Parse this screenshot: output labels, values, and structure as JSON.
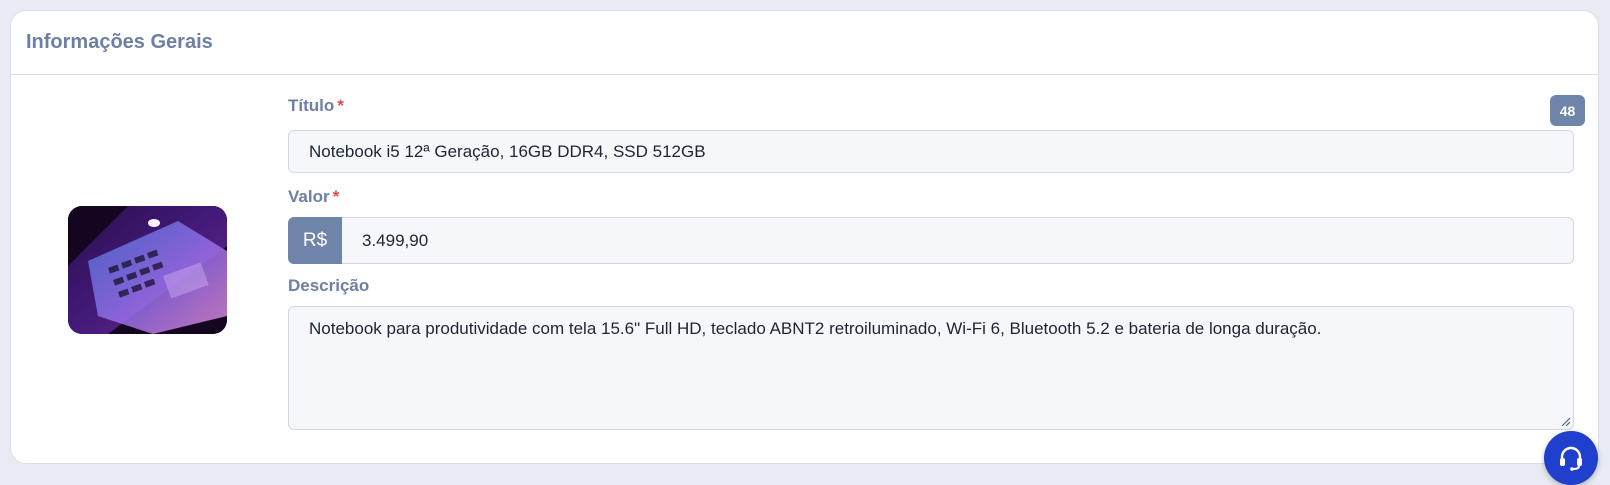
{
  "section": {
    "title": "Informações Gerais"
  },
  "form": {
    "title": {
      "label": "Título",
      "required_mark": "*",
      "value": "Notebook i5 12ª Geração, 16GB DDR4, SSD 512GB",
      "char_count": "48"
    },
    "price": {
      "label": "Valor",
      "required_mark": "*",
      "currency_prefix": "R$",
      "value": "3.499,90"
    },
    "description": {
      "label": "Descrição",
      "value": "Notebook para produtividade com tela 15.6\" Full HD, teclado ABNT2 retroiluminado, Wi-Fi 6, Bluetooth 5.2 e bateria de longa duração."
    }
  },
  "icons": {
    "product_image": "laptop-photo",
    "support": "headset-icon"
  },
  "colors": {
    "accent": "#6e84a8",
    "label": "#6e7fa3",
    "required": "#e04b4b",
    "support_button": "#1f3fcc"
  }
}
